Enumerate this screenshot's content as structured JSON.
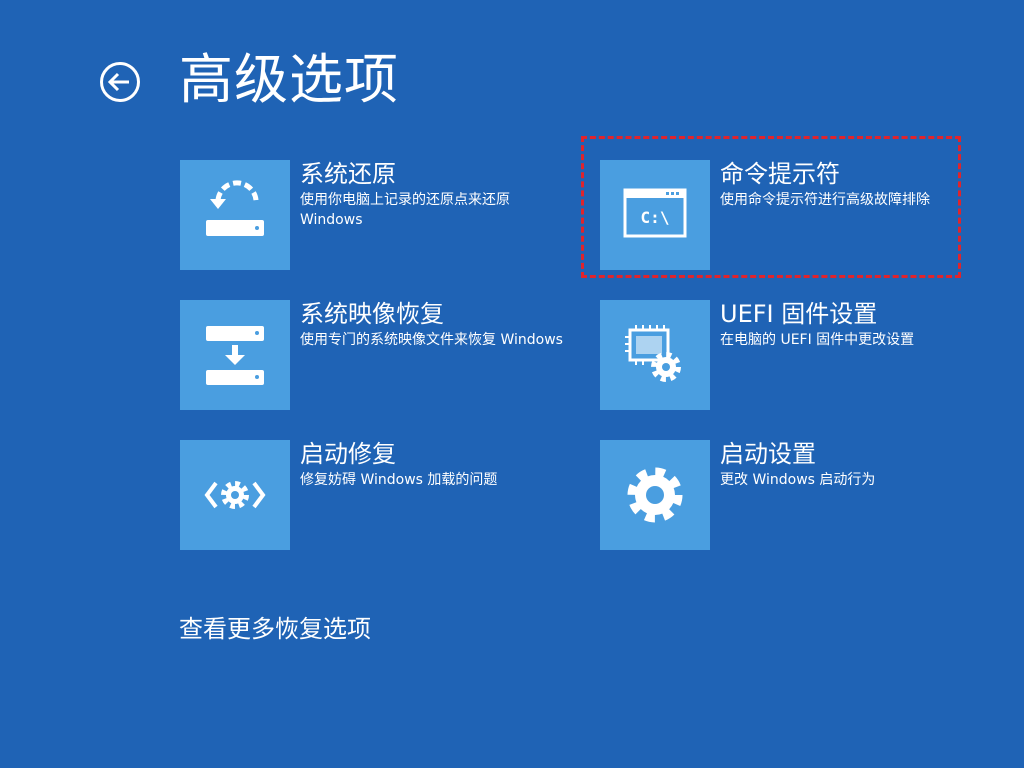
{
  "page": {
    "title": "高级选项",
    "back_icon": "back-arrow-icon",
    "more_options_label": "查看更多恢复选项"
  },
  "colors": {
    "background": "#1f63b5",
    "tile": "#4a9ee0",
    "highlight": "#e0242c",
    "text": "#ffffff"
  },
  "options": [
    {
      "icon": "system-restore-icon",
      "title": "系统还原",
      "description": "使用你电脑上记录的还原点来还原 Windows"
    },
    {
      "icon": "command-prompt-icon",
      "title": "命令提示符",
      "description": "使用命令提示符进行高级故障排除",
      "icon_text": "C:\\"
    },
    {
      "icon": "system-image-recovery-icon",
      "title": "系统映像恢复",
      "description": "使用专门的系统映像文件来恢复 Windows"
    },
    {
      "icon": "uefi-firmware-icon",
      "title": "UEFI 固件设置",
      "description": "在电脑的 UEFI 固件中更改设置"
    },
    {
      "icon": "startup-repair-icon",
      "title": "启动修复",
      "description": "修复妨碍 Windows 加载的问题"
    },
    {
      "icon": "gear-icon",
      "title": "启动设置",
      "description": "更改 Windows 启动行为"
    }
  ]
}
